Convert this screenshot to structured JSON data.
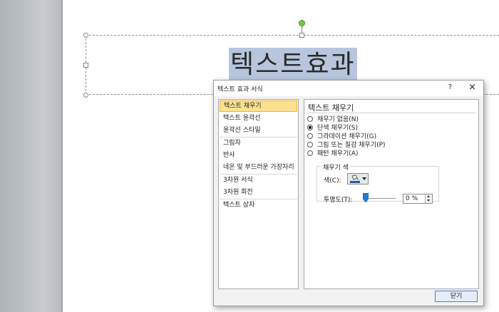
{
  "slide": {
    "text": "텍스트효과"
  },
  "dialog": {
    "title": "텍스트 효과 서식",
    "help": "?",
    "close_icon": "×",
    "nav": [
      "텍스트 채우기",
      "텍스트 윤곽선",
      "윤곽선 스타일",
      "그림자",
      "반사",
      "네온 및 부드러운 가장자리",
      "3차원 서식",
      "3차원 회전",
      "텍스트 상자"
    ],
    "selected_nav": "텍스트 채우기",
    "panel": {
      "title": "텍스트 채우기",
      "options": [
        {
          "label": "채우기 없음(N)",
          "checked": false
        },
        {
          "label": "단색 채우기(S)",
          "checked": true
        },
        {
          "label": "그라데이션 채우기(G)",
          "checked": false
        },
        {
          "label": "그림 또는 질감 채우기(P)",
          "checked": false
        },
        {
          "label": "패턴 채우기(A)",
          "checked": false
        }
      ],
      "fill_color": {
        "group_label": "채우기 색",
        "color_label": "색(C):",
        "transparency_label": "투명도(T):",
        "transparency_value": "0 %",
        "transparency_fraction": 0,
        "swatch_color": "#1f5fa8"
      }
    },
    "close_button": "닫기"
  },
  "colors": {
    "selection_highlight": "#b7c6dd",
    "rotate_handle": "#7ac943",
    "nav_selected_bg": "#fce290"
  }
}
